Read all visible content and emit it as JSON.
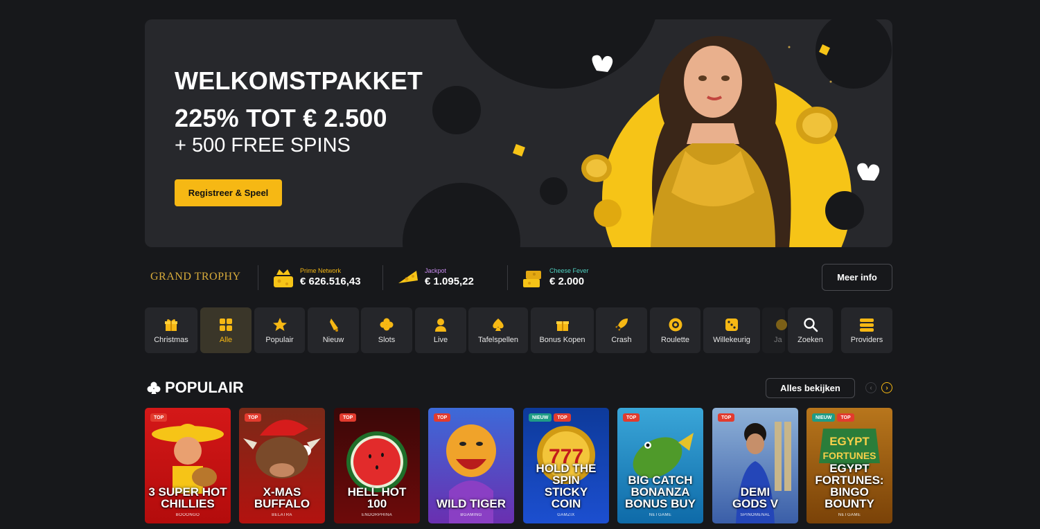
{
  "hero": {
    "line1": "WELKOMSTPAKKET",
    "line2": "225% TOT € 2.500",
    "line3": "+ 500 FREE SPINS",
    "button": "Registreer & Speel"
  },
  "jackpots": {
    "brand": "GRAND TROPHY",
    "items": [
      {
        "label": "Prime Network",
        "value": "€ 626.516,43",
        "color": "#f6b814",
        "icon": "cheese-crown-icon"
      },
      {
        "label": "Jackpot",
        "value": "€ 1.095,22",
        "color": "#c98cf0",
        "icon": "cheese-wedge-icon"
      },
      {
        "label": "Cheese Fever",
        "value": "€ 2.000",
        "color": "#4fd2c2",
        "icon": "cheese-stack-icon"
      }
    ],
    "more_button": "Meer info"
  },
  "categories": [
    {
      "label": "Christmas",
      "icon": "gift-icon"
    },
    {
      "label": "Alle",
      "icon": "grid-icon",
      "active": true
    },
    {
      "label": "Populair",
      "icon": "star-icon"
    },
    {
      "label": "Nieuw",
      "icon": "bell-icon"
    },
    {
      "label": "Slots",
      "icon": "clover-icon"
    },
    {
      "label": "Live",
      "icon": "dealer-icon"
    },
    {
      "label": "Tafelspellen",
      "icon": "spade-icon"
    },
    {
      "label": "Bonus Kopen",
      "icon": "gift-icon"
    },
    {
      "label": "Crash",
      "icon": "rocket-icon"
    },
    {
      "label": "Roulette",
      "icon": "roulette-icon"
    },
    {
      "label": "Willekeurig",
      "icon": "dice-icon"
    },
    {
      "label": "Ja",
      "icon": "jackpot-icon"
    },
    {
      "label": "Zoeken",
      "icon": "search-icon"
    },
    {
      "label": "Providers",
      "icon": "providers-icon"
    }
  ],
  "popular": {
    "title": "POPULAIR",
    "view_all": "Alles bekijken",
    "games": [
      {
        "name": "3 SUPER HOT CHILLIES",
        "provider": "BOOONGO",
        "badges": [
          "TOP"
        ]
      },
      {
        "name": "X-MAS BUFFALO",
        "provider": "BELATRA",
        "badges": [
          "TOP"
        ]
      },
      {
        "name": "HELL HOT 100",
        "provider": "ENDORPHINA",
        "badges": [
          "TOP"
        ]
      },
      {
        "name": "WILD TIGER",
        "provider": "BGAMING",
        "badges": [
          "TOP"
        ]
      },
      {
        "name": "HOLD THE SPIN STICKY COIN",
        "provider": "GAMZIX",
        "badges": [
          "NIEUW",
          "TOP"
        ]
      },
      {
        "name": "BIG CATCH BONANZA BONUS BUY",
        "provider": "NETGAME",
        "badges": [
          "TOP"
        ]
      },
      {
        "name": "DEMI GODS V",
        "provider": "SPINOMENAL",
        "badges": [
          "TOP"
        ]
      },
      {
        "name": "EGYPT FORTUNES: BINGO BOUNTY",
        "provider": "NETGAME",
        "badges": [
          "NIEUW",
          "TOP"
        ]
      }
    ]
  },
  "colors": {
    "accent": "#f6b814",
    "background": "#17181b",
    "card": "#25262a"
  }
}
